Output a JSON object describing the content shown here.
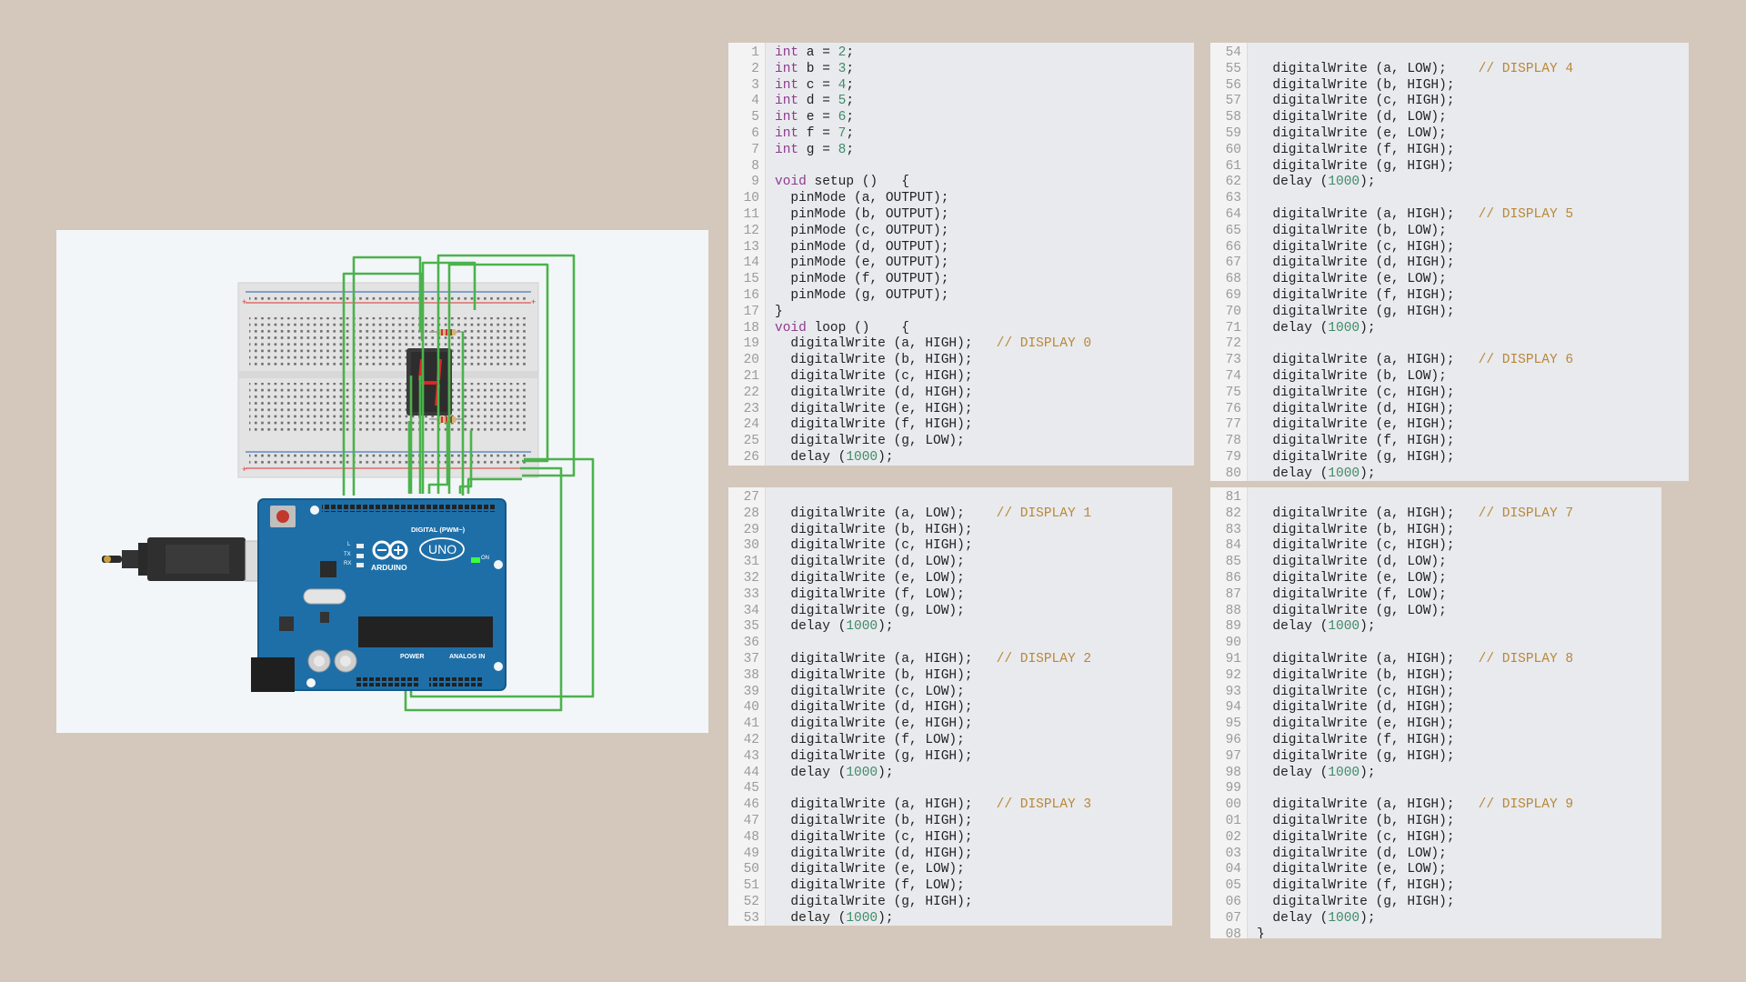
{
  "circuit": {
    "display_digit": "4",
    "board_labels": {
      "brand": "ARDUINO",
      "model": "UNO",
      "digital": "DIGITAL (PWM~)",
      "power": "POWER",
      "analog": "ANALOG IN",
      "on": "ON",
      "tx": "TX",
      "rx": "RX",
      "l": "L"
    }
  },
  "code_panels": [
    {
      "id": "panel-1",
      "lines": [
        {
          "n": "1",
          "tokens": [
            {
              "t": "int",
              "c": "kw"
            },
            {
              "t": " a = "
            },
            {
              "t": "2",
              "c": "num"
            },
            {
              "t": ";"
            }
          ]
        },
        {
          "n": "2",
          "tokens": [
            {
              "t": "int",
              "c": "kw"
            },
            {
              "t": " b = "
            },
            {
              "t": "3",
              "c": "num"
            },
            {
              "t": ";"
            }
          ]
        },
        {
          "n": "3",
          "tokens": [
            {
              "t": "int",
              "c": "kw"
            },
            {
              "t": " c = "
            },
            {
              "t": "4",
              "c": "num"
            },
            {
              "t": ";"
            }
          ]
        },
        {
          "n": "4",
          "tokens": [
            {
              "t": "int",
              "c": "kw"
            },
            {
              "t": " d = "
            },
            {
              "t": "5",
              "c": "num"
            },
            {
              "t": ";"
            }
          ]
        },
        {
          "n": "5",
          "tokens": [
            {
              "t": "int",
              "c": "kw"
            },
            {
              "t": " e = "
            },
            {
              "t": "6",
              "c": "num"
            },
            {
              "t": ";"
            }
          ]
        },
        {
          "n": "6",
          "tokens": [
            {
              "t": "int",
              "c": "kw"
            },
            {
              "t": " f = "
            },
            {
              "t": "7",
              "c": "num"
            },
            {
              "t": ";"
            }
          ]
        },
        {
          "n": "7",
          "tokens": [
            {
              "t": "int",
              "c": "kw"
            },
            {
              "t": " g = "
            },
            {
              "t": "8",
              "c": "num"
            },
            {
              "t": ";"
            }
          ]
        },
        {
          "n": "8",
          "tokens": []
        },
        {
          "n": "9",
          "tokens": [
            {
              "t": "void",
              "c": "kw"
            },
            {
              "t": " setup ()   {"
            }
          ]
        },
        {
          "n": "10",
          "tokens": [
            {
              "t": "  pinMode (a, OUTPUT);"
            }
          ]
        },
        {
          "n": "11",
          "tokens": [
            {
              "t": "  pinMode (b, OUTPUT);"
            }
          ]
        },
        {
          "n": "12",
          "tokens": [
            {
              "t": "  pinMode (c, OUTPUT);"
            }
          ]
        },
        {
          "n": "13",
          "tokens": [
            {
              "t": "  pinMode (d, OUTPUT);"
            }
          ]
        },
        {
          "n": "14",
          "tokens": [
            {
              "t": "  pinMode (e, OUTPUT);"
            }
          ]
        },
        {
          "n": "15",
          "tokens": [
            {
              "t": "  pinMode (f, OUTPUT);"
            }
          ]
        },
        {
          "n": "16",
          "tokens": [
            {
              "t": "  pinMode (g, OUTPUT);"
            }
          ]
        },
        {
          "n": "17",
          "tokens": [
            {
              "t": "}"
            }
          ]
        },
        {
          "n": "18",
          "tokens": [
            {
              "t": "void",
              "c": "kw"
            },
            {
              "t": " loop ()    {"
            }
          ]
        },
        {
          "n": "19",
          "tokens": [
            {
              "t": "  digitalWrite (a, HIGH);   "
            },
            {
              "t": "// DISPLAY 0",
              "c": "cm"
            }
          ]
        },
        {
          "n": "20",
          "tokens": [
            {
              "t": "  digitalWrite (b, HIGH);"
            }
          ]
        },
        {
          "n": "21",
          "tokens": [
            {
              "t": "  digitalWrite (c, HIGH);"
            }
          ]
        },
        {
          "n": "22",
          "tokens": [
            {
              "t": "  digitalWrite (d, HIGH);"
            }
          ]
        },
        {
          "n": "23",
          "tokens": [
            {
              "t": "  digitalWrite (e, HIGH);"
            }
          ]
        },
        {
          "n": "24",
          "tokens": [
            {
              "t": "  digitalWrite (f, HIGH);"
            }
          ]
        },
        {
          "n": "25",
          "tokens": [
            {
              "t": "  digitalWrite (g, LOW);"
            }
          ]
        },
        {
          "n": "26",
          "tokens": [
            {
              "t": "  delay ("
            },
            {
              "t": "1000",
              "c": "num"
            },
            {
              "t": ");"
            }
          ]
        }
      ]
    },
    {
      "id": "panel-2",
      "lines": [
        {
          "n": "54",
          "tokens": []
        },
        {
          "n": "55",
          "tokens": [
            {
              "t": "  digitalWrite (a, LOW);    "
            },
            {
              "t": "// DISPLAY 4",
              "c": "cm"
            }
          ]
        },
        {
          "n": "56",
          "tokens": [
            {
              "t": "  digitalWrite (b, HIGH);"
            }
          ]
        },
        {
          "n": "57",
          "tokens": [
            {
              "t": "  digitalWrite (c, HIGH);"
            }
          ]
        },
        {
          "n": "58",
          "tokens": [
            {
              "t": "  digitalWrite (d, LOW);"
            }
          ]
        },
        {
          "n": "59",
          "tokens": [
            {
              "t": "  digitalWrite (e, LOW);"
            }
          ]
        },
        {
          "n": "60",
          "tokens": [
            {
              "t": "  digitalWrite (f, HIGH);"
            }
          ]
        },
        {
          "n": "61",
          "tokens": [
            {
              "t": "  digitalWrite (g, HIGH);"
            }
          ]
        },
        {
          "n": "62",
          "tokens": [
            {
              "t": "  delay ("
            },
            {
              "t": "1000",
              "c": "num"
            },
            {
              "t": ");"
            }
          ]
        },
        {
          "n": "63",
          "tokens": []
        },
        {
          "n": "64",
          "tokens": [
            {
              "t": "  digitalWrite (a, HIGH);   "
            },
            {
              "t": "// DISPLAY 5",
              "c": "cm"
            }
          ]
        },
        {
          "n": "65",
          "tokens": [
            {
              "t": "  digitalWrite (b, LOW);"
            }
          ]
        },
        {
          "n": "66",
          "tokens": [
            {
              "t": "  digitalWrite (c, HIGH);"
            }
          ]
        },
        {
          "n": "67",
          "tokens": [
            {
              "t": "  digitalWrite (d, HIGH);"
            }
          ]
        },
        {
          "n": "68",
          "tokens": [
            {
              "t": "  digitalWrite (e, LOW);"
            }
          ]
        },
        {
          "n": "69",
          "tokens": [
            {
              "t": "  digitalWrite (f, HIGH);"
            }
          ]
        },
        {
          "n": "70",
          "tokens": [
            {
              "t": "  digitalWrite (g, HIGH);"
            }
          ]
        },
        {
          "n": "71",
          "tokens": [
            {
              "t": "  delay ("
            },
            {
              "t": "1000",
              "c": "num"
            },
            {
              "t": ");"
            }
          ]
        },
        {
          "n": "72",
          "tokens": []
        },
        {
          "n": "73",
          "tokens": [
            {
              "t": "  digitalWrite (a, HIGH);   "
            },
            {
              "t": "// DISPLAY 6",
              "c": "cm"
            }
          ]
        },
        {
          "n": "74",
          "tokens": [
            {
              "t": "  digitalWrite (b, LOW);"
            }
          ]
        },
        {
          "n": "75",
          "tokens": [
            {
              "t": "  digitalWrite (c, HIGH);"
            }
          ]
        },
        {
          "n": "76",
          "tokens": [
            {
              "t": "  digitalWrite (d, HIGH);"
            }
          ]
        },
        {
          "n": "77",
          "tokens": [
            {
              "t": "  digitalWrite (e, HIGH);"
            }
          ]
        },
        {
          "n": "78",
          "tokens": [
            {
              "t": "  digitalWrite (f, HIGH);"
            }
          ]
        },
        {
          "n": "79",
          "tokens": [
            {
              "t": "  digitalWrite (g, HIGH);"
            }
          ]
        },
        {
          "n": "80",
          "tokens": [
            {
              "t": "  delay ("
            },
            {
              "t": "1000",
              "c": "num"
            },
            {
              "t": ");"
            }
          ]
        }
      ]
    },
    {
      "id": "panel-3",
      "lines": [
        {
          "n": "27",
          "tokens": []
        },
        {
          "n": "28",
          "tokens": [
            {
              "t": "  digitalWrite (a, LOW);    "
            },
            {
              "t": "// DISPLAY 1",
              "c": "cm"
            }
          ]
        },
        {
          "n": "29",
          "tokens": [
            {
              "t": "  digitalWrite (b, HIGH);"
            }
          ]
        },
        {
          "n": "30",
          "tokens": [
            {
              "t": "  digitalWrite (c, HIGH);"
            }
          ]
        },
        {
          "n": "31",
          "tokens": [
            {
              "t": "  digitalWrite (d, LOW);"
            }
          ]
        },
        {
          "n": "32",
          "tokens": [
            {
              "t": "  digitalWrite (e, LOW);"
            }
          ]
        },
        {
          "n": "33",
          "tokens": [
            {
              "t": "  digitalWrite (f, LOW);"
            }
          ]
        },
        {
          "n": "34",
          "tokens": [
            {
              "t": "  digitalWrite (g, LOW);"
            }
          ]
        },
        {
          "n": "35",
          "tokens": [
            {
              "t": "  delay ("
            },
            {
              "t": "1000",
              "c": "num"
            },
            {
              "t": ");"
            }
          ]
        },
        {
          "n": "36",
          "tokens": []
        },
        {
          "n": "37",
          "tokens": [
            {
              "t": "  digitalWrite (a, HIGH);   "
            },
            {
              "t": "// DISPLAY 2",
              "c": "cm"
            }
          ]
        },
        {
          "n": "38",
          "tokens": [
            {
              "t": "  digitalWrite (b, HIGH);"
            }
          ]
        },
        {
          "n": "39",
          "tokens": [
            {
              "t": "  digitalWrite (c, LOW);"
            }
          ]
        },
        {
          "n": "40",
          "tokens": [
            {
              "t": "  digitalWrite (d, HIGH);"
            }
          ]
        },
        {
          "n": "41",
          "tokens": [
            {
              "t": "  digitalWrite (e, HIGH);"
            }
          ]
        },
        {
          "n": "42",
          "tokens": [
            {
              "t": "  digitalWrite (f, LOW);"
            }
          ]
        },
        {
          "n": "43",
          "tokens": [
            {
              "t": "  digitalWrite (g, HIGH);"
            }
          ]
        },
        {
          "n": "44",
          "tokens": [
            {
              "t": "  delay ("
            },
            {
              "t": "1000",
              "c": "num"
            },
            {
              "t": ");"
            }
          ]
        },
        {
          "n": "45",
          "tokens": []
        },
        {
          "n": "46",
          "tokens": [
            {
              "t": "  digitalWrite (a, HIGH);   "
            },
            {
              "t": "// DISPLAY 3",
              "c": "cm"
            }
          ]
        },
        {
          "n": "47",
          "tokens": [
            {
              "t": "  digitalWrite (b, HIGH);"
            }
          ]
        },
        {
          "n": "48",
          "tokens": [
            {
              "t": "  digitalWrite (c, HIGH);"
            }
          ]
        },
        {
          "n": "49",
          "tokens": [
            {
              "t": "  digitalWrite (d, HIGH);"
            }
          ]
        },
        {
          "n": "50",
          "tokens": [
            {
              "t": "  digitalWrite (e, LOW);"
            }
          ]
        },
        {
          "n": "51",
          "tokens": [
            {
              "t": "  digitalWrite (f, LOW);"
            }
          ]
        },
        {
          "n": "52",
          "tokens": [
            {
              "t": "  digitalWrite (g, HIGH);"
            }
          ]
        },
        {
          "n": "53",
          "tokens": [
            {
              "t": "  delay ("
            },
            {
              "t": "1000",
              "c": "num"
            },
            {
              "t": ");"
            }
          ]
        }
      ]
    },
    {
      "id": "panel-4",
      "lines": [
        {
          "n": "81",
          "tokens": []
        },
        {
          "n": "82",
          "tokens": [
            {
              "t": "  digitalWrite (a, HIGH);   "
            },
            {
              "t": "// DISPLAY 7",
              "c": "cm"
            }
          ]
        },
        {
          "n": "83",
          "tokens": [
            {
              "t": "  digitalWrite (b, HIGH);"
            }
          ]
        },
        {
          "n": "84",
          "tokens": [
            {
              "t": "  digitalWrite (c, HIGH);"
            }
          ]
        },
        {
          "n": "85",
          "tokens": [
            {
              "t": "  digitalWrite (d, LOW);"
            }
          ]
        },
        {
          "n": "86",
          "tokens": [
            {
              "t": "  digitalWrite (e, LOW);"
            }
          ]
        },
        {
          "n": "87",
          "tokens": [
            {
              "t": "  digitalWrite (f, LOW);"
            }
          ]
        },
        {
          "n": "88",
          "tokens": [
            {
              "t": "  digitalWrite (g, LOW);"
            }
          ]
        },
        {
          "n": "89",
          "tokens": [
            {
              "t": "  delay ("
            },
            {
              "t": "1000",
              "c": "num"
            },
            {
              "t": ");"
            }
          ]
        },
        {
          "n": "90",
          "tokens": []
        },
        {
          "n": "91",
          "tokens": [
            {
              "t": "  digitalWrite (a, HIGH);   "
            },
            {
              "t": "// DISPLAY 8",
              "c": "cm"
            }
          ]
        },
        {
          "n": "92",
          "tokens": [
            {
              "t": "  digitalWrite (b, HIGH);"
            }
          ]
        },
        {
          "n": "93",
          "tokens": [
            {
              "t": "  digitalWrite (c, HIGH);"
            }
          ]
        },
        {
          "n": "94",
          "tokens": [
            {
              "t": "  digitalWrite (d, HIGH);"
            }
          ]
        },
        {
          "n": "95",
          "tokens": [
            {
              "t": "  digitalWrite (e, HIGH);"
            }
          ]
        },
        {
          "n": "96",
          "tokens": [
            {
              "t": "  digitalWrite (f, HIGH);"
            }
          ]
        },
        {
          "n": "97",
          "tokens": [
            {
              "t": "  digitalWrite (g, HIGH);"
            }
          ]
        },
        {
          "n": "98",
          "tokens": [
            {
              "t": "  delay ("
            },
            {
              "t": "1000",
              "c": "num"
            },
            {
              "t": ");"
            }
          ]
        },
        {
          "n": "99",
          "tokens": []
        },
        {
          "n": "00",
          "tokens": [
            {
              "t": "  digitalWrite (a, HIGH);   "
            },
            {
              "t": "// DISPLAY 9",
              "c": "cm"
            }
          ]
        },
        {
          "n": "01",
          "tokens": [
            {
              "t": "  digitalWrite (b, HIGH);"
            }
          ]
        },
        {
          "n": "02",
          "tokens": [
            {
              "t": "  digitalWrite (c, HIGH);"
            }
          ]
        },
        {
          "n": "03",
          "tokens": [
            {
              "t": "  digitalWrite (d, LOW);"
            }
          ]
        },
        {
          "n": "04",
          "tokens": [
            {
              "t": "  digitalWrite (e, LOW);"
            }
          ]
        },
        {
          "n": "05",
          "tokens": [
            {
              "t": "  digitalWrite (f, HIGH);"
            }
          ]
        },
        {
          "n": "06",
          "tokens": [
            {
              "t": "  digitalWrite (g, HIGH);"
            }
          ]
        },
        {
          "n": "07",
          "tokens": [
            {
              "t": "  delay ("
            },
            {
              "t": "1000",
              "c": "num"
            },
            {
              "t": ");"
            }
          ]
        },
        {
          "n": "08",
          "tokens": [
            {
              "t": "}"
            }
          ]
        }
      ]
    }
  ]
}
